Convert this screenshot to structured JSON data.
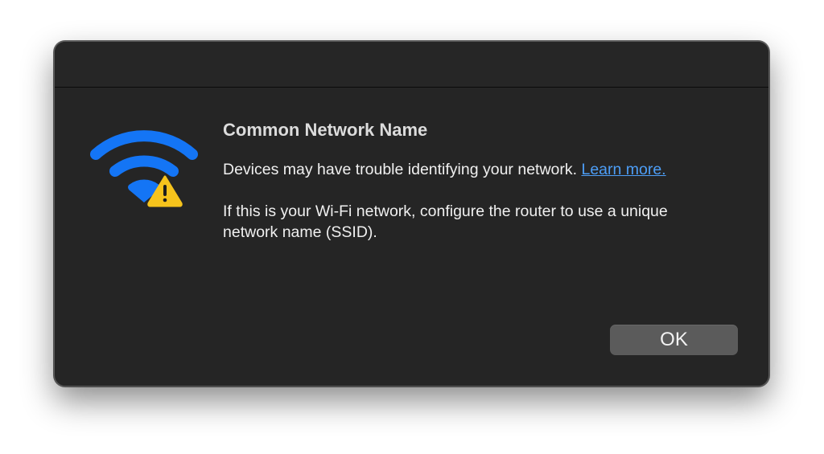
{
  "dialog": {
    "title": "Common Network Name",
    "message_text": "Devices may have trouble identifying your network.",
    "learn_more_label": "Learn more.",
    "detail_text": "If this is your Wi-Fi network, configure the router to use a unique network name (SSID).",
    "ok_label": "OK",
    "icon": "wifi-warning-icon"
  },
  "colors": {
    "background": "#252525",
    "wifi_blue": "#1475f5",
    "warning_yellow": "#f6c31c",
    "link_blue": "#4d9ef7",
    "button_gray": "#5b5b5b"
  }
}
